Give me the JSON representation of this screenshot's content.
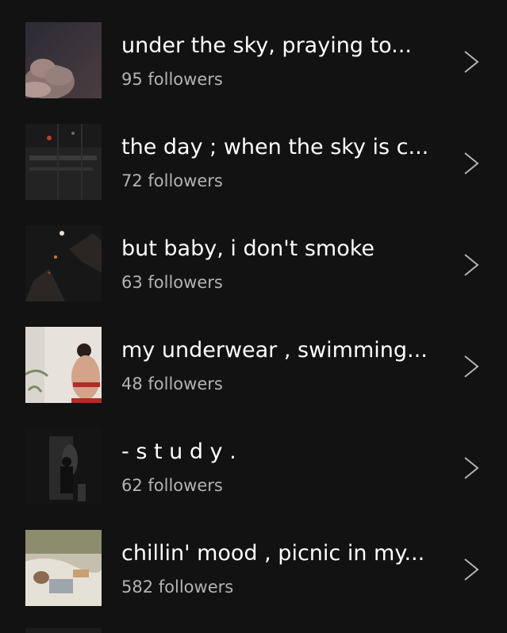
{
  "playlists": [
    {
      "title": "under the sky, praying to...",
      "followers": "95 followers",
      "thumb_icon": "cloudy-sky-image"
    },
    {
      "title": "the day ; when the sky is c...",
      "followers": "72 followers",
      "thumb_icon": "rainy-night-street-image"
    },
    {
      "title": "but baby, i don't smoke",
      "followers": "63 followers",
      "thumb_icon": "moon-night-image"
    },
    {
      "title": "my underwear , swimming...",
      "followers": "48 followers",
      "thumb_icon": "person-back-image"
    },
    {
      "title": "- s t u d y .",
      "followers": "62 followers",
      "thumb_icon": "dark-room-image"
    },
    {
      "title": "chillin' mood , picnic in my...",
      "followers": "582 followers",
      "thumb_icon": "picnic-image"
    }
  ]
}
